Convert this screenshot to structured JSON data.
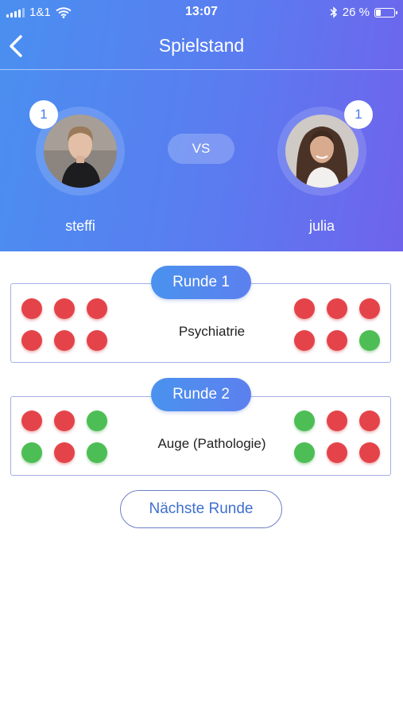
{
  "status_bar": {
    "carrier": "1&1",
    "time": "13:07",
    "battery": "26 %"
  },
  "nav": {
    "title": "Spielstand"
  },
  "players": {
    "left": {
      "name": "steffi",
      "score": "1"
    },
    "right": {
      "name": "julia",
      "score": "1"
    },
    "vs": "VS"
  },
  "rounds": [
    {
      "label": "Runde 1",
      "category": "Psychiatrie",
      "left_results": [
        "red",
        "red",
        "red",
        "red",
        "red",
        "red"
      ],
      "right_results": [
        "red",
        "red",
        "red",
        "red",
        "red",
        "green"
      ]
    },
    {
      "label": "Runde 2",
      "category": "Auge (Pathologie)",
      "left_results": [
        "red",
        "red",
        "green",
        "green",
        "red",
        "green"
      ],
      "right_results": [
        "green",
        "red",
        "red",
        "green",
        "red",
        "red"
      ]
    }
  ],
  "next_button": "Nächste Runde",
  "colors": {
    "correct": "#4cbe55",
    "wrong": "#e5434a",
    "accent": "#4a8ff0"
  }
}
